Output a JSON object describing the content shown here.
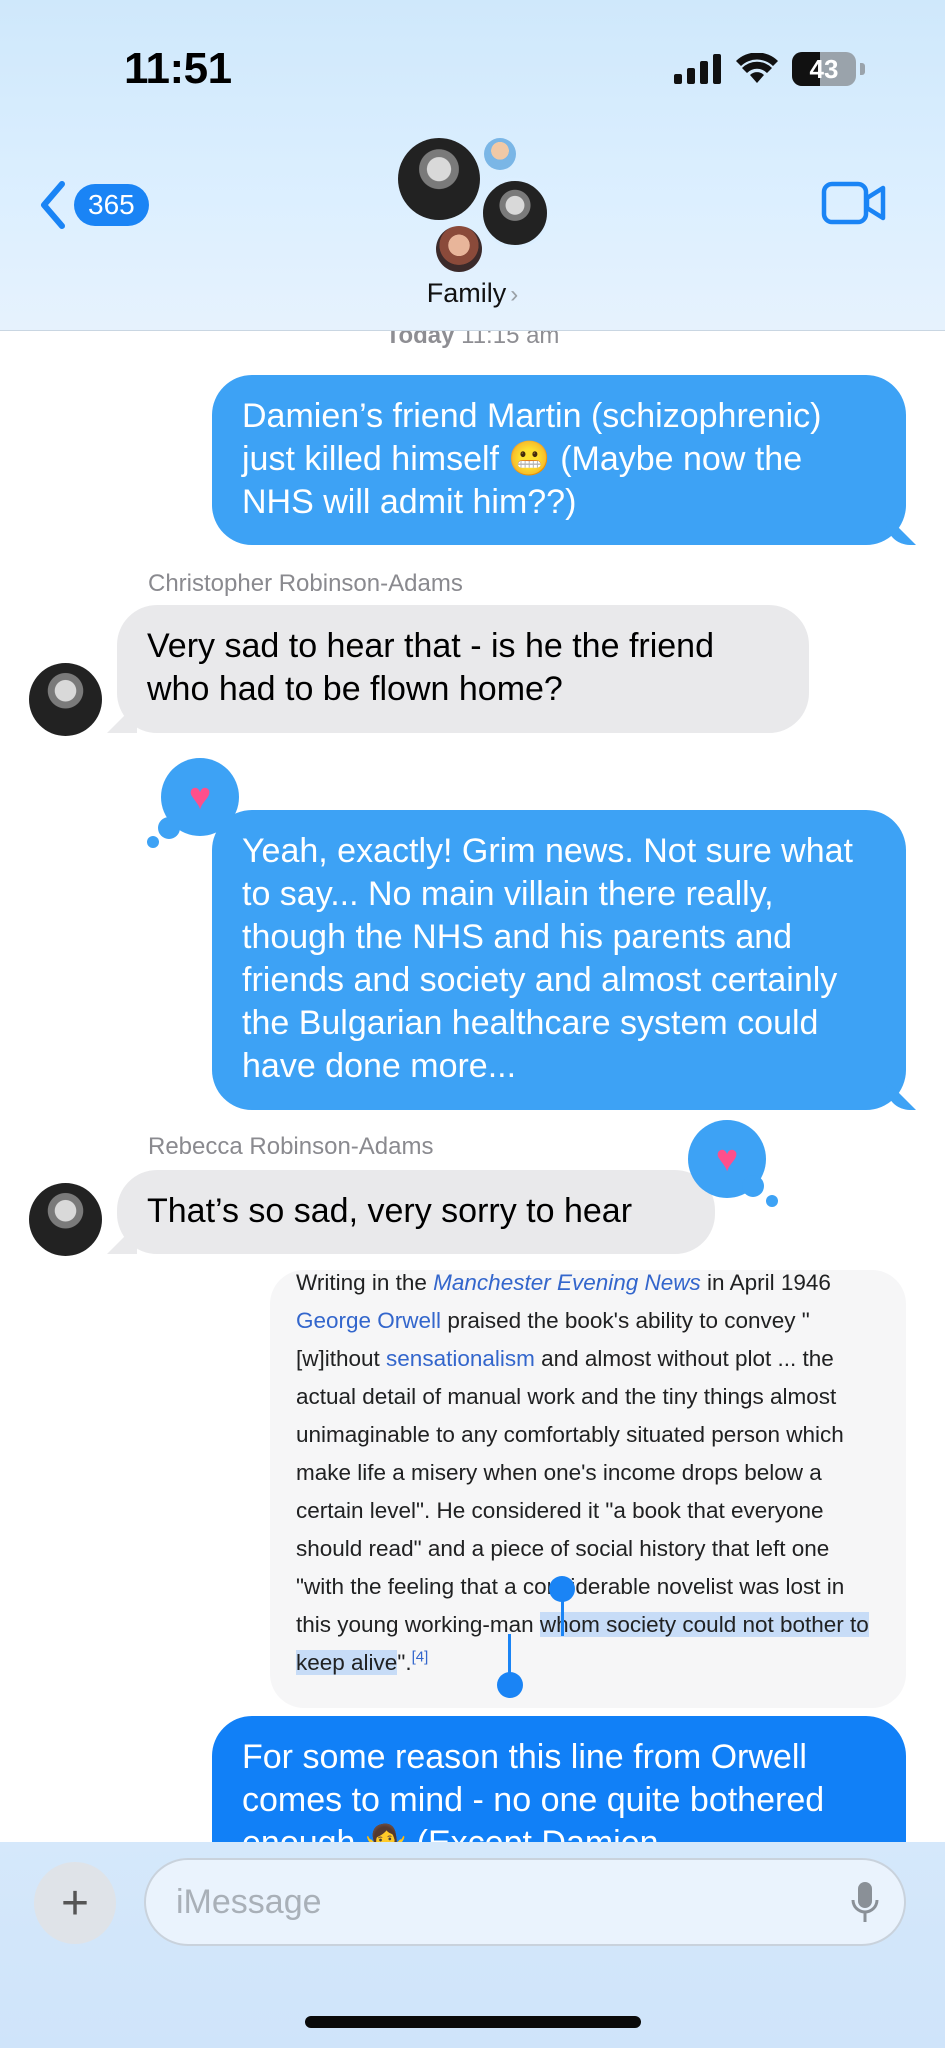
{
  "status_bar": {
    "time": "11:51",
    "battery": "43"
  },
  "header": {
    "back_count": "365",
    "group_name": "Family",
    "chevron": "›"
  },
  "timestamp": {
    "day": "Today",
    "time": "11:15 am"
  },
  "messages": [
    {
      "direction": "outgoing",
      "text": "Damien’s friend Martin (schizophrenic) just killed himself 😬 (Maybe now the NHS will admit him??)"
    },
    {
      "direction": "incoming",
      "sender": "Christopher Robinson-Adams",
      "text": "Very sad to hear that - is he the friend who had to be flown home?"
    },
    {
      "direction": "outgoing",
      "reaction": "♥",
      "text": "Yeah, exactly! Grim news. Not sure what to say... No main villain there really, though the NHS and his parents and friends and society and almost certainly the Bulgarian healthcare system could have done more..."
    },
    {
      "direction": "incoming",
      "sender": "Rebecca Robinson-Adams",
      "reaction": "♥",
      "text": "That’s so sad, very sorry to hear"
    },
    {
      "direction": "outgoing",
      "text": "For some reason this line from Orwell comes to mind - no one quite bothered enough 🤷‍♀️ (Except Damien"
    }
  ],
  "article": {
    "p1_a": "Writing in the ",
    "p1_link": "Manchester Evening News",
    "p1_b": " in April 1946 ",
    "orwell": "George Orwell",
    "p2": " praised the book's ability to convey \"[w]ithout ",
    "sensationalism": "sensationalism",
    "p3": " and almost without plot ... the actual detail of manual work and the tiny things almost unimaginable to any comfortably situated person which make life a misery when one's income drops below a certain level\". He considered it \"a book that everyone should read\" and a piece of social history that left one \"with the feeling that a considerable novelist was lost in this young working-man ",
    "selected": "whom society could not bother to keep alive",
    "end": "\".",
    "cite": "[4]"
  },
  "composer": {
    "placeholder": "iMessage"
  },
  "colors": {
    "outgoing_bubble": "#3da2f5",
    "outgoing_bubble_latest": "#1180f7",
    "incoming_bubble": "#e9e9eb",
    "reaction_heart": "#ff4f8b",
    "link": "#3366cc",
    "selection": "#c7dcf7"
  }
}
